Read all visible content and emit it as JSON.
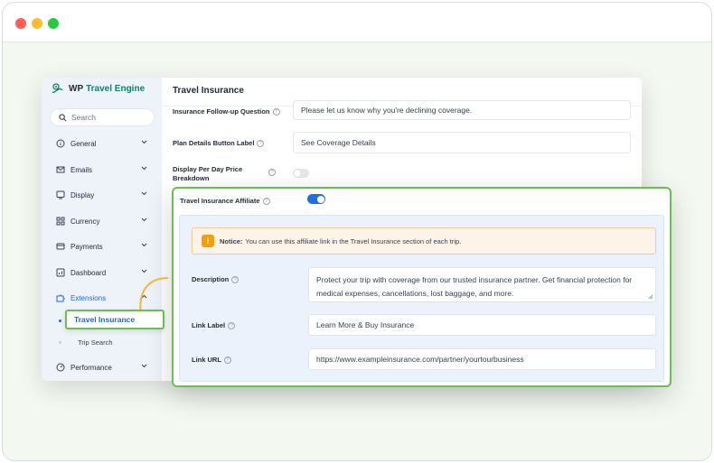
{
  "window": {
    "controls": [
      "close",
      "minimize",
      "maximize"
    ]
  },
  "sidebar": {
    "brand": {
      "name": "WP",
      "accent": "Travel Engine"
    },
    "search_placeholder": "Search",
    "items": [
      {
        "label": "General",
        "icon": "info-icon"
      },
      {
        "label": "Emails",
        "icon": "mail-icon"
      },
      {
        "label": "Display",
        "icon": "monitor-icon"
      },
      {
        "label": "Currency",
        "icon": "grid-icon"
      },
      {
        "label": "Payments",
        "icon": "card-icon"
      },
      {
        "label": "Dashboard",
        "icon": "chart-icon"
      },
      {
        "label": "Extensions",
        "icon": "puzzle-icon",
        "expanded": true
      },
      {
        "label": "Performance",
        "icon": "gauge-icon"
      }
    ],
    "sub_items": [
      "Travel Insurance",
      "Trip Search"
    ]
  },
  "main": {
    "title": "Travel Insurance",
    "rows": [
      {
        "label": "Insurance Follow-up Question",
        "value": "Please let us know why you're declining coverage."
      },
      {
        "label": "Plan Details Button Label",
        "value": "See Coverage Details"
      },
      {
        "label_line1": "Display Per Day Price",
        "label_line2": "Breakdown",
        "toggle": false
      }
    ]
  },
  "affiliate": {
    "label": "Travel Insurance Affiliate",
    "toggle": true,
    "notice_title": "Notice:",
    "notice_text": "You can use this affiliate link in the Travel Insurance section of each trip.",
    "description_label": "Description",
    "description_line1": "Protect your trip with coverage from our trusted insurance partner. Get financial protection for",
    "description_line2": "medical expenses, cancellations, lost baggage, and more.",
    "link_label_label": "Link Label",
    "link_label_value": "Learn More & Buy Insurance",
    "link_url_label": "Link URL",
    "link_url_value": "https://www.exampleinsurance.com/partner/yourtourbusiness"
  },
  "callout": {
    "label": "Travel Insurance"
  },
  "colors": {
    "accent_green": "#6bbf4e",
    "link_blue": "#2563eb",
    "toggle_blue": "#1d6fe0",
    "notice_bg": "#fdf3e8"
  }
}
